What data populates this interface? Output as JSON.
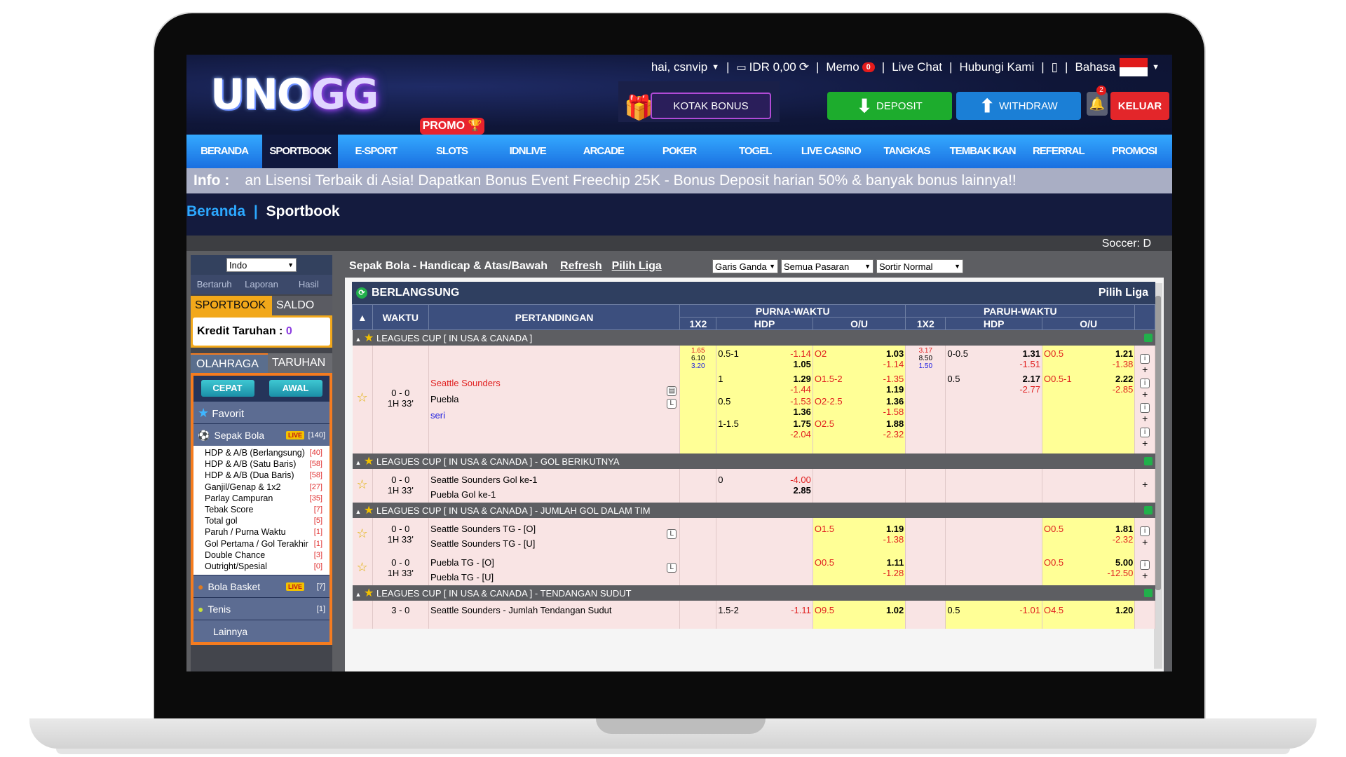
{
  "header": {
    "logo_main": "UNO",
    "logo_accent": "GG",
    "greeting": "hai, csnvip",
    "balance": "IDR 0,00",
    "memo": "Memo",
    "memo_count": "0",
    "live_chat": "Live Chat",
    "contact": "Hubungi Kami",
    "language": "Bahasa",
    "bonus_box": "KOTAK BONUS",
    "deposit": "DEPOSIT",
    "withdraw": "WITHDRAW",
    "notif_count": "2",
    "logout": "KELUAR",
    "promo_tag": "PROMO"
  },
  "nav": [
    "BERANDA",
    "SPORTBOOK",
    "E-SPORT",
    "SLOTS",
    "IDNLIVE",
    "ARCADE",
    "POKER",
    "TOGEL",
    "LIVE CASINO",
    "TANGKAS",
    "TEMBAK IKAN",
    "REFERRAL",
    "PROMOSI"
  ],
  "info": {
    "label": "Info :",
    "text": "an Lisensi Terbaik di Asia! Dapatkan Bonus Event Freechip 25K - Bonus Deposit harian 50% & banyak bonus lainnya!!"
  },
  "breadcrumb": {
    "home": "Beranda",
    "sep": "|",
    "current": "Sportbook"
  },
  "soccer_header": "Soccer: D",
  "left": {
    "odds_format": "Indo",
    "links": [
      "Bertaruh",
      "Laporan",
      "Hasil"
    ],
    "tab_sportbook": "SPORTBOOK",
    "tab_saldo": "SALDO",
    "kredit_label": "Kredit Taruhan :",
    "kredit_value": "0",
    "tab_olahraga": "OLAHRAGA",
    "tab_taruhan": "TARUHAN",
    "cepat": "CEPAT",
    "awal": "AWAL",
    "favorit": "Favorit",
    "soccer": {
      "name": "Sepak Bola",
      "live": "LIVE",
      "count": "[140]"
    },
    "submenu": [
      {
        "label": "HDP & A/B (Berlangsung)",
        "count": "[40]"
      },
      {
        "label": "HDP & A/B (Satu Baris)",
        "count": "[58]"
      },
      {
        "label": "HDP & A/B (Dua Baris)",
        "count": "[58]"
      },
      {
        "label": "Ganjil/Genap & 1x2",
        "count": "[27]"
      },
      {
        "label": "Parlay Campuran",
        "count": "[35]"
      },
      {
        "label": "Tebak Score",
        "count": "[7]"
      },
      {
        "label": "Total gol",
        "count": "[5]"
      },
      {
        "label": "Paruh / Purna Waktu",
        "count": "[1]"
      },
      {
        "label": "Gol Pertama / Gol Terakhir",
        "count": "[1]"
      },
      {
        "label": "Double Chance",
        "count": "[3]"
      },
      {
        "label": "Outright/Spesial",
        "count": "[0]"
      }
    ],
    "basket": {
      "name": "Bola Basket",
      "live": "LIVE",
      "count": "[7]"
    },
    "tenis": {
      "name": "Tenis",
      "count": "[1]"
    },
    "lainnya": "Lainnya"
  },
  "main": {
    "title": "Sepak Bola - Handicap & Atas/Bawah",
    "refresh": "Refresh",
    "pilih_liga": "Pilih Liga",
    "dropdowns": [
      "Garis Ganda",
      "Semua Pasaran",
      "Sortir Normal"
    ],
    "live_title": "BERLANGSUNG",
    "live_pilih": "Pilih Liga",
    "headers": {
      "waktu": "WAKTU",
      "pertandingan": "PERTANDINGAN",
      "purna": "PURNA-WAKTU",
      "paruh": "PARUH-WAKTU",
      "x12": "1X2",
      "hdp": "HDP",
      "ou": "O/U"
    },
    "leagues": [
      "LEAGUES CUP [ IN USA & CANADA ]",
      "LEAGUES CUP [ IN USA & CANADA ] - GOL BERIKUTNYA",
      "LEAGUES CUP [ IN USA & CANADA ] - JUMLAH GOL DALAM TIM",
      "LEAGUES CUP [ IN USA & CANADA ] - TENDANGAN SUDUT"
    ],
    "match1": {
      "score": "0 - 0",
      "time": "1H 33'",
      "home": "Seattle Sounders",
      "away": "Puebla",
      "draw": "seri",
      "x12_ft": [
        "1.65",
        "6.10",
        "3.20"
      ],
      "x12_ht": [
        "3.17",
        "8.50",
        "1.50"
      ],
      "lines": [
        {
          "hdp": "0.5-1",
          "h1": "-1.14",
          "h2": "1.05",
          "ou": "O2",
          "o1": "1.03",
          "o2": "-1.14",
          "hhdp": "0-0.5",
          "hh1": "1.31",
          "hh2": "-1.51",
          "hou": "O0.5",
          "ho1": "1.21",
          "ho2": "-1.38"
        },
        {
          "hdp": "1",
          "h1": "1.29",
          "h2": "-1.44",
          "ou": "O1.5-2",
          "o1": "-1.35",
          "o2": "1.19",
          "hhdp": "0.5",
          "hh1": "2.17",
          "hh2": "-2.77",
          "hou": "O0.5-1",
          "ho1": "2.22",
          "ho2": "-2.85"
        },
        {
          "hdp": "0.5",
          "h1": "-1.53",
          "h2": "1.36",
          "ou": "O2-2.5",
          "o1": "1.36",
          "o2": "-1.58"
        },
        {
          "hdp": "1-1.5",
          "h1": "1.75",
          "h2": "-2.04",
          "ou": "O2.5",
          "o1": "1.88",
          "o2": "-2.32"
        }
      ]
    },
    "match2": {
      "score": "0 - 0",
      "time": "1H 33'",
      "home": "Seattle Sounders Gol ke-1",
      "away": "Puebla Gol ke-1",
      "hdp": "0",
      "h1": "-4.00",
      "h2": "2.85"
    },
    "match3": {
      "score": "0 - 0",
      "time": "1H 33'",
      "home": "Seattle Sounders TG - [O]",
      "away": "Seattle Sounders TG - [U]",
      "ou": "O1.5",
      "o1": "1.19",
      "o2": "-1.38",
      "hou": "O0.5",
      "ho1": "1.81",
      "ho2": "-2.32"
    },
    "match4": {
      "score": "0 - 0",
      "time": "1H 33'",
      "home": "Puebla TG - [O]",
      "away": "Puebla TG - [U]",
      "ou": "O0.5",
      "o1": "1.11",
      "o2": "-1.28",
      "hou": "O0.5",
      "ho1": "5.00",
      "ho2": "-12.50"
    },
    "match5": {
      "score": "3 - 0",
      "home": "Seattle Sounders - Jumlah Tendangan Sudut",
      "hdp": "1.5-2",
      "h1": "-1.11",
      "ou": "O9.5",
      "o1": "1.02",
      "hhdp": "0.5",
      "hh1": "-1.01",
      "hou": "O4.5",
      "ho1": "1.20"
    }
  }
}
